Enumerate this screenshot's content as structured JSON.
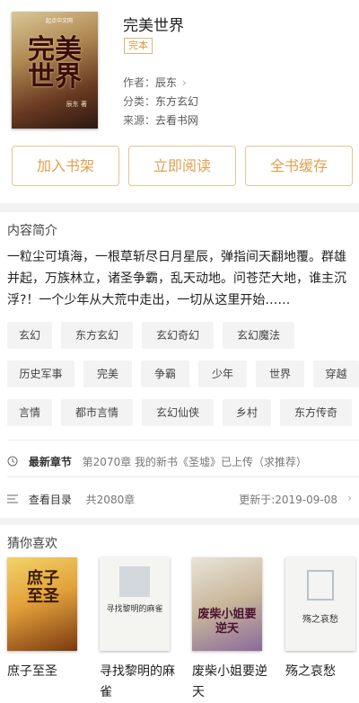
{
  "book": {
    "cover": {
      "top_text": "起点中文网",
      "title": "完美世界",
      "author": "辰东 著"
    },
    "title": "完美世界",
    "status": "完本",
    "author_label": "作者：",
    "author": "辰东",
    "category_label": "分类：",
    "category": "东方玄幻",
    "source_label": "来源：",
    "source": "去看书网"
  },
  "actions": {
    "add_shelf": "加入书架",
    "read_now": "立即阅读",
    "cache_all": "全书缓存"
  },
  "intro": {
    "heading": "内容简介",
    "text": "一粒尘可填海，一根草斩尽日月星辰，弹指间天翻地覆。群雄并起，万族林立，诸圣争霸，乱天动地。问苍茫大地，谁主沉浮?！一个少年从大荒中走出，一切从这里开始……"
  },
  "tags": [
    [
      "玄幻",
      "东方玄幻",
      "玄幻奇幻",
      "玄幻魔法"
    ],
    [
      "历史军事",
      "完美",
      "争霸",
      "少年",
      "世界",
      "穿越"
    ],
    [
      "言情",
      "都市言情",
      "玄幻仙侠",
      "乡村",
      "东方传奇"
    ]
  ],
  "latest": {
    "icon": "clock-icon",
    "label": "最新章节",
    "chapter": "第2070章 我的新书《圣墟》已上传（求推荐）"
  },
  "catalog": {
    "icon": "list-icon",
    "label": "查看目录",
    "count": "共2080章",
    "updated": "更新于:2019-09-08"
  },
  "recommend": {
    "heading": "猜你喜欢",
    "items": [
      {
        "title": "庶子至圣",
        "cover_text": "庶子至圣"
      },
      {
        "title": "寻找黎明的麻雀",
        "cover_text": "寻找黎明的麻雀"
      },
      {
        "title": "废柴小姐要逆天",
        "cover_text": "废柴小姐要逆天"
      },
      {
        "title": "殇之哀愁",
        "cover_text": "殇之哀愁"
      }
    ]
  },
  "colors": {
    "accent": "#e0a050",
    "accent_border": "#e6c48f",
    "tag_bg": "#f3f3f3"
  }
}
